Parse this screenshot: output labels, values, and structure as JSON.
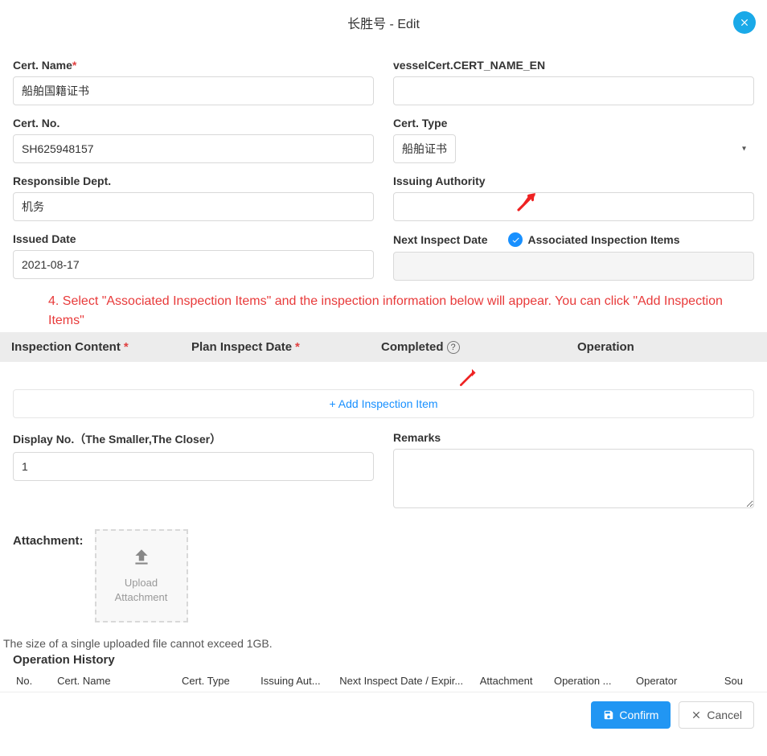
{
  "header": {
    "title": "长胜号 - Edit"
  },
  "form": {
    "certName": {
      "label": "Cert. Name",
      "required": "*",
      "value": "船舶国籍证书"
    },
    "certNameEn": {
      "label": "vesselCert.CERT_NAME_EN",
      "value": ""
    },
    "certNo": {
      "label": "Cert. No.",
      "value": "SH625948157"
    },
    "certType": {
      "label": "Cert. Type",
      "value": "船舶证书"
    },
    "responsibleDept": {
      "label": "Responsible Dept.",
      "value": "机务"
    },
    "issuingAuthority": {
      "label": "Issuing Authority",
      "value": ""
    },
    "issuedDate": {
      "label": "Issued Date",
      "value": "2021-08-17"
    },
    "nextInspectDate": {
      "label": "Next Inspect Date",
      "value": ""
    },
    "assocInspection": {
      "label": "Associated Inspection Items",
      "checked": true
    },
    "displayNo": {
      "label": "Display No.（The Smaller,The Closer）",
      "value": "1"
    },
    "remarks": {
      "label": "Remarks",
      "value": ""
    }
  },
  "annotation": {
    "text": "4. Select \"Associated Inspection Items\" and the inspection information below will appear. You can click \"Add Inspection Items\""
  },
  "inspectionHeader": {
    "content": "Inspection Content",
    "planDate": "Plan Inspect Date",
    "completed": "Completed",
    "operation": "Operation",
    "star": "*"
  },
  "addInspection": {
    "label": "+ Add Inspection Item"
  },
  "attachment": {
    "label": "Attachment:",
    "uploadLine1": "Upload",
    "uploadLine2": "Attachment",
    "note": "The size of a single uploaded file cannot exceed 1GB."
  },
  "operationHistory": {
    "title": "Operation History",
    "cols": {
      "no": "No.",
      "certName": "Cert. Name",
      "certType": "Cert. Type",
      "issuingAuth": "Issuing Aut...",
      "nextInspect": "Next Inspect Date / Expir...",
      "attachment": "Attachment",
      "operation": "Operation ...",
      "operator": "Operator",
      "source": "Sou"
    }
  },
  "footer": {
    "confirm": "Confirm",
    "cancel": "Cancel"
  }
}
